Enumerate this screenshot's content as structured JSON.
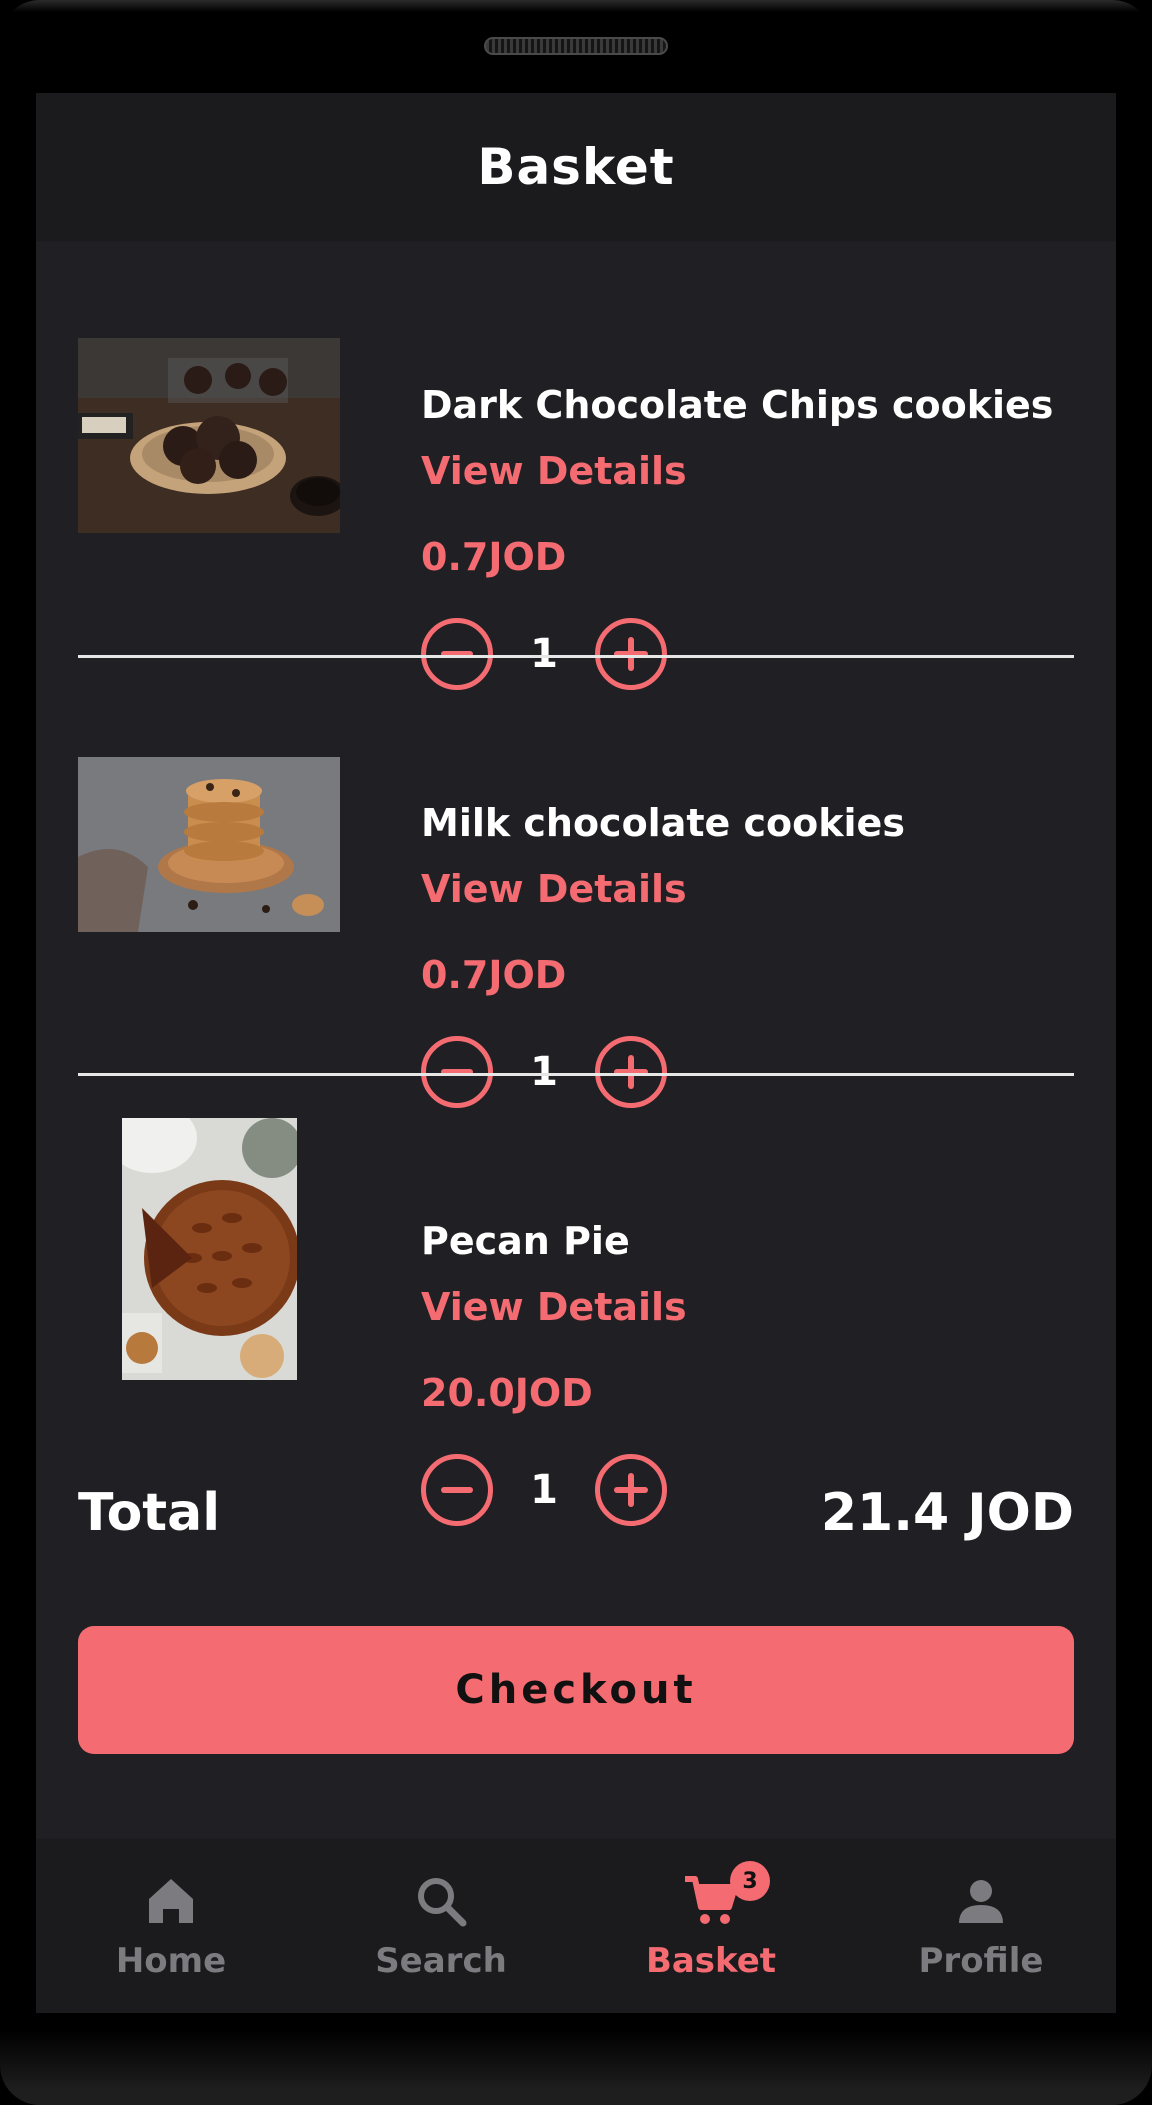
{
  "header": {
    "title": "Basket"
  },
  "items": [
    {
      "name": "Dark Chocolate Chips cookies",
      "details_label": "View Details",
      "price": "0.7JOD",
      "quantity": "1"
    },
    {
      "name": "Milk chocolate cookies",
      "details_label": "View Details",
      "price": "0.7JOD",
      "quantity": "1"
    },
    {
      "name": "Pecan Pie",
      "details_label": "View Details",
      "price": "20.0JOD",
      "quantity": "1"
    }
  ],
  "summary": {
    "total_label": "Total",
    "total_value": "21.4 JOD"
  },
  "checkout": {
    "label": "Checkout"
  },
  "nav": {
    "items": [
      {
        "label": "Home",
        "icon": "home-icon"
      },
      {
        "label": "Search",
        "icon": "search-icon"
      },
      {
        "label": "Basket",
        "icon": "cart-icon",
        "badge": "3",
        "active": true
      },
      {
        "label": "Profile",
        "icon": "person-icon"
      }
    ]
  },
  "colors": {
    "accent": "#f46c72",
    "background": "#202024",
    "bar": "#1b1b1e",
    "inactive": "#7c7c80"
  }
}
